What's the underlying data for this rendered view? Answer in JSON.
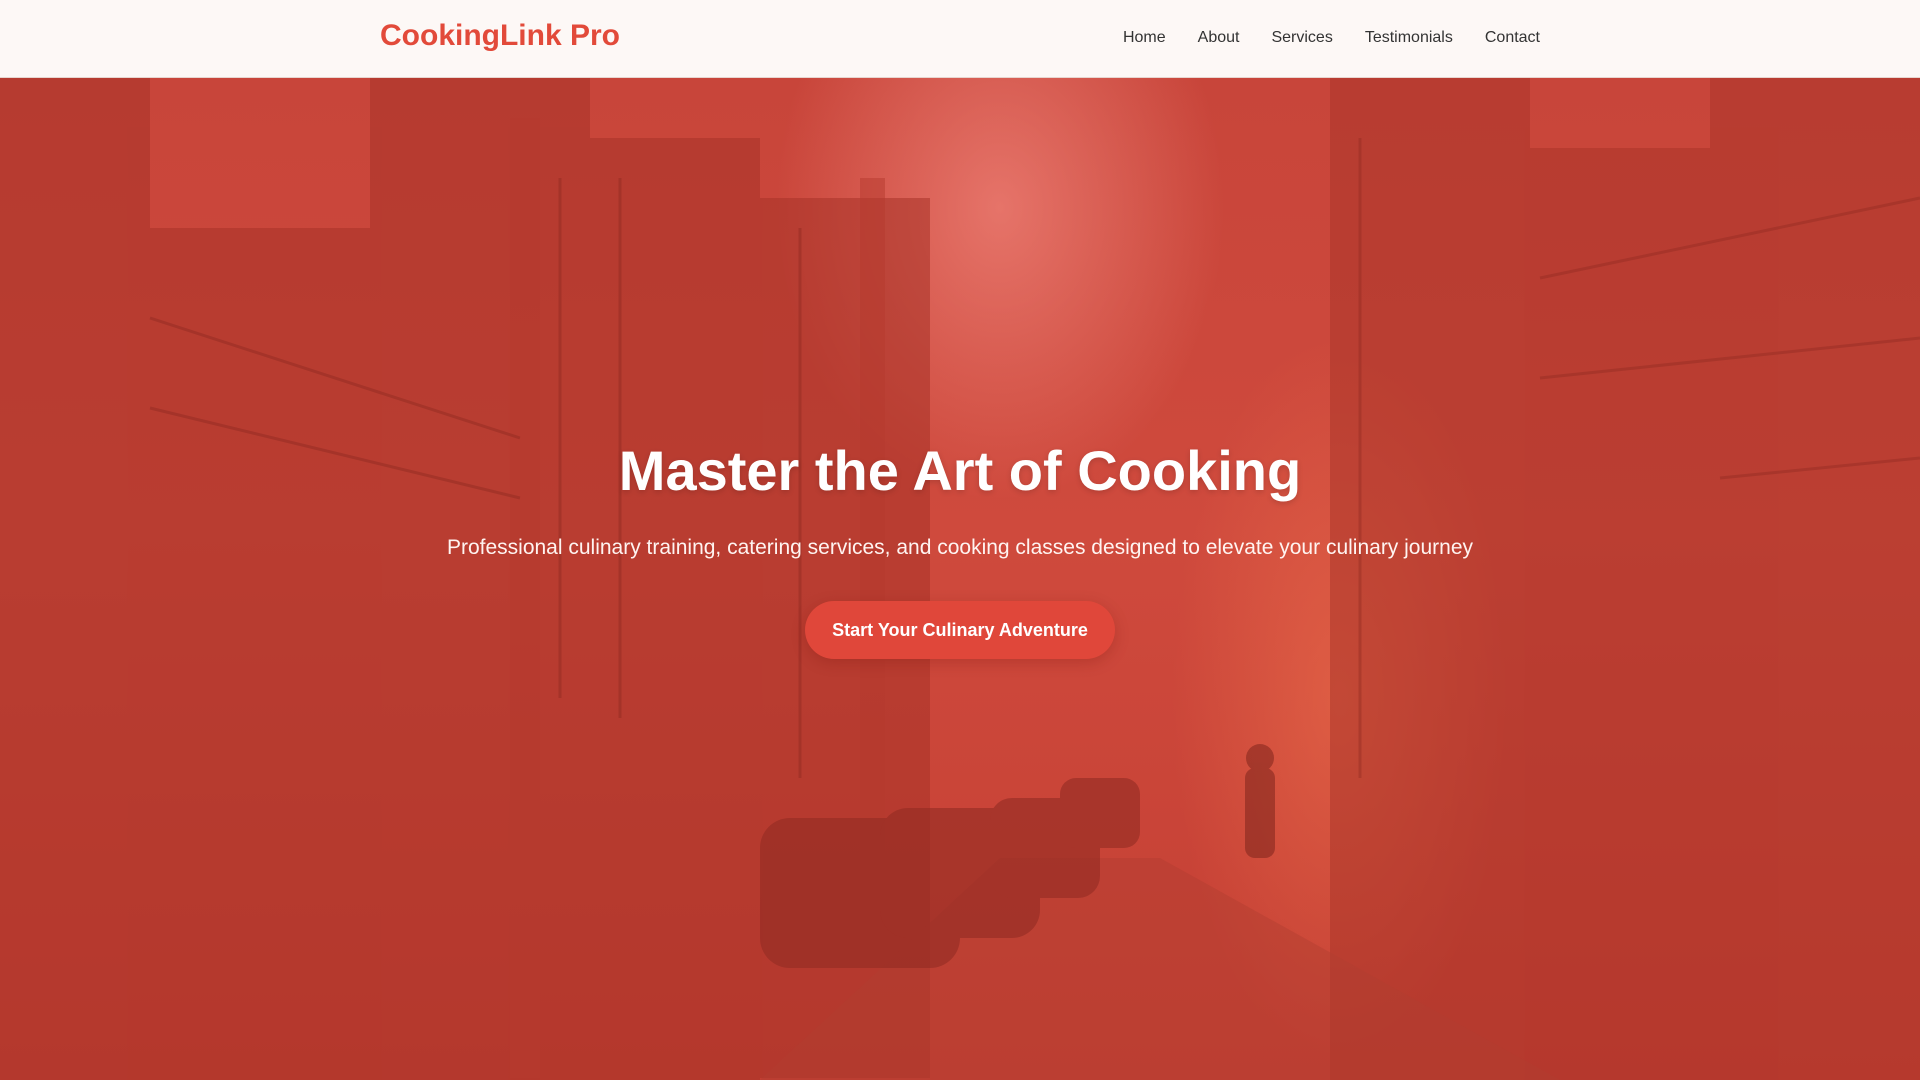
{
  "header": {
    "logo": "CookingLink Pro",
    "nav": [
      "Home",
      "About",
      "Services",
      "Testimonials",
      "Contact"
    ]
  },
  "hero": {
    "title": "Master the Art of Cooking",
    "subtitle": "Professional culinary training, catering services, and cooking classes designed to elevate your culinary journey",
    "cta_label": "Start Your Culinary Adventure"
  },
  "colors": {
    "brand": "#e24a3a",
    "hero_overlay": "#c8453a",
    "nav_text": "#333333",
    "nav_background": "#fdf8f6"
  },
  "background_image": "city-street-photo"
}
